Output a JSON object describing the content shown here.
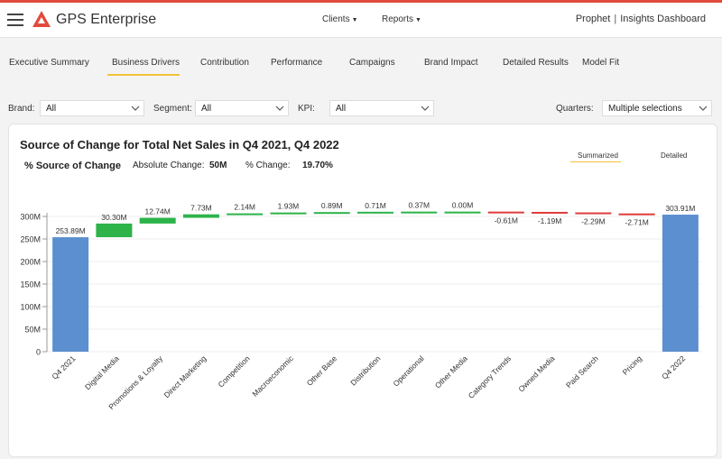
{
  "header": {
    "app_title": "GPS Enterprise",
    "menus": [
      {
        "label": "Clients"
      },
      {
        "label": "Reports"
      }
    ],
    "right": {
      "org": "Prophet",
      "product": "Insights Dashboard"
    }
  },
  "tabs": [
    {
      "label": "Executive Summary"
    },
    {
      "label": "Business Drivers",
      "active": true
    },
    {
      "label": "Contribution"
    },
    {
      "label": "Performance"
    },
    {
      "label": "Campaigns"
    },
    {
      "label": "Brand Impact"
    },
    {
      "label": "Detailed Results"
    },
    {
      "label": "Model Fit"
    }
  ],
  "filters": {
    "brand": {
      "label": "Brand:",
      "value": "All"
    },
    "segment": {
      "label": "Segment:",
      "value": "All"
    },
    "kpi": {
      "label": "KPI:",
      "value": "All"
    },
    "quarters": {
      "label": "Quarters:",
      "value": "Multiple selections"
    }
  },
  "card": {
    "title": "Source of Change for Total Net Sales in Q4 2021, Q4 2022",
    "subtitle": "% Source of Change",
    "abs_change_label": "Absolute Change:",
    "abs_change_value": "50M",
    "pct_change_label": "% Change:",
    "pct_change_value": "19.70%",
    "toggle_summarized": "Summarized",
    "toggle_detailed": "Detailed"
  },
  "colors": {
    "accent": "#e14b3b",
    "positive": "#2db34a",
    "negative": "#e03a3a",
    "total": "#5b8fcf",
    "tab_highlight": "#f2c23a"
  },
  "chart_data": {
    "type": "waterfall",
    "title": "Source of Change for Total Net Sales in Q4 2021, Q4 2022",
    "ylim": [
      0,
      300
    ],
    "yticks": [
      "0",
      "50M",
      "100M",
      "150M",
      "200M",
      "250M",
      "300M"
    ],
    "bars": [
      {
        "category": "Q4 2021",
        "value": 253.89,
        "label": "253.89M",
        "kind": "total"
      },
      {
        "category": "Digital Media",
        "value": 30.3,
        "label": "30.30M",
        "kind": "delta"
      },
      {
        "category": "Promotions & Loyalty",
        "value": 12.74,
        "label": "12.74M",
        "kind": "delta"
      },
      {
        "category": "Direct Marketing",
        "value": 7.73,
        "label": "7.73M",
        "kind": "delta"
      },
      {
        "category": "Competition",
        "value": 2.14,
        "label": "2.14M",
        "kind": "delta"
      },
      {
        "category": "Macroeconomic",
        "value": 1.93,
        "label": "1.93M",
        "kind": "delta"
      },
      {
        "category": "Other Base",
        "value": 0.89,
        "label": "0.89M",
        "kind": "delta"
      },
      {
        "category": "Distribution",
        "value": 0.71,
        "label": "0.71M",
        "kind": "delta"
      },
      {
        "category": "Operational",
        "value": 0.37,
        "label": "0.37M",
        "kind": "delta"
      },
      {
        "category": "Other Media",
        "value": 0.0,
        "label": "0.00M",
        "kind": "delta"
      },
      {
        "category": "Category Trends",
        "value": -0.61,
        "label": "-0.61M",
        "kind": "delta"
      },
      {
        "category": "Owned Media",
        "value": -1.19,
        "label": "-1.19M",
        "kind": "delta"
      },
      {
        "category": "Paid Search",
        "value": -2.29,
        "label": "-2.29M",
        "kind": "delta"
      },
      {
        "category": "Pricing",
        "value": -2.71,
        "label": "-2.71M",
        "kind": "delta"
      },
      {
        "category": "Q4 2022",
        "value": 303.91,
        "label": "303.91M",
        "kind": "total"
      }
    ]
  }
}
